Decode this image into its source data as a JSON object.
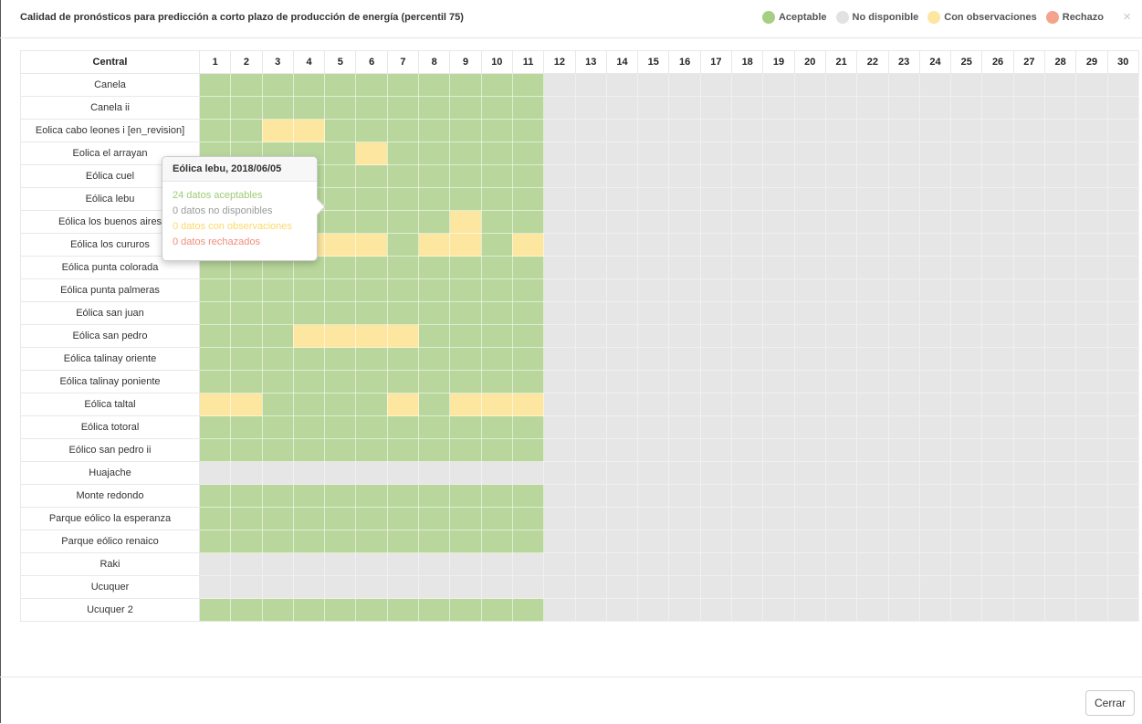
{
  "title": "Calidad de pronósticos para predicción a corto plazo de producción de energía (percentil 75)",
  "legend": [
    {
      "label": "Aceptable",
      "color": "#a6cf83"
    },
    {
      "label": "No disponible",
      "color": "#e2e2e2"
    },
    {
      "label": "Con observaciones",
      "color": "#fde6a0"
    },
    {
      "label": "Rechazo",
      "color": "#f4a48c"
    }
  ],
  "close_icon": "close-icon",
  "table": {
    "central_header": "Central",
    "days": [
      "1",
      "2",
      "3",
      "4",
      "5",
      "6",
      "7",
      "8",
      "9",
      "10",
      "11",
      "12",
      "13",
      "14",
      "15",
      "16",
      "17",
      "18",
      "19",
      "20",
      "21",
      "22",
      "23",
      "24",
      "25",
      "26",
      "27",
      "28",
      "29",
      "30"
    ],
    "status_colors": {
      "A": "#b9d79c",
      "N": "#e6e6e6",
      "O": "#fde6a0",
      "R": "#f4a48c"
    },
    "rows": [
      {
        "name": "Canela",
        "status": "AAAAAAAAAAANNNNNNNNNNNNNNNNNNN"
      },
      {
        "name": "Canela ii",
        "status": "AAAAAAAAAAANNNNNNNNNNNNNNNNNNN"
      },
      {
        "name": "Eolica cabo leones i [en_revision]",
        "status": "AAOOAAAAAAANNNNNNNNNNNNNNNNNNN"
      },
      {
        "name": "Eolica el arrayan",
        "status": "AAAAAOAAAAANNNNNNNNNNNNNNNNNNN"
      },
      {
        "name": "Eólica cuel",
        "status": "AAAAAAAAAAANNNNNNNNNNNNNNNNNNN"
      },
      {
        "name": "Eólica lebu",
        "status": "AAAAAAAAAAANNNNNNNNNNNNNNNNNNN"
      },
      {
        "name": "Eólica los buenos aires",
        "status": "AAAAAAAAOAANNNNNNNNNNNNNNNNNNN"
      },
      {
        "name": "Eólica los cururos",
        "status": "OOOOOOAOOAONNNNNNNNNNNNNNNNNNN"
      },
      {
        "name": "Eólica punta colorada",
        "status": "AAAAAAAAAAANNNNNNNNNNNNNNNNNNN"
      },
      {
        "name": "Eólica punta palmeras",
        "status": "AAAAAAAAAAANNNNNNNNNNNNNNNNNNN"
      },
      {
        "name": "Eólica san juan",
        "status": "AAAAAAAAAAANNNNNNNNNNNNNNNNNNN"
      },
      {
        "name": "Eólica san pedro",
        "status": "AAAOOOOAAAANNNNNNNNNNNNNNNNNNN"
      },
      {
        "name": "Eólica talinay oriente",
        "status": "AAAAAAAAAAANNNNNNNNNNNNNNNNNNN"
      },
      {
        "name": "Eólica talinay poniente",
        "status": "AAAAAAAAAAANNNNNNNNNNNNNNNNNNN"
      },
      {
        "name": "Eólica taltal",
        "status": "OOAAAAOAOOONNNNNNNNNNNNNNNNNNN"
      },
      {
        "name": "Eólica totoral",
        "status": "AAAAAAAAAAANNNNNNNNNNNNNNNNNNN"
      },
      {
        "name": "Eólico san pedro ii",
        "status": "AAAAAAAAAAANNNNNNNNNNNNNNNNNNN"
      },
      {
        "name": "Huajache",
        "status": "NNNNNNNNNNNNNNNNNNNNNNNNNNNNNN"
      },
      {
        "name": "Monte redondo",
        "status": "AAAAAAAAAAANNNNNNNNNNNNNNNNNNN"
      },
      {
        "name": "Parque eólico la esperanza",
        "status": "AAAAAAAAAAANNNNNNNNNNNNNNNNNNN"
      },
      {
        "name": "Parque eólico renaico",
        "status": "AAAAAAAAAAANNNNNNNNNNNNNNNNNNN"
      },
      {
        "name": "Raki",
        "status": "NNNNNNNNNNNNNNNNNNNNNNNNNNNNNN"
      },
      {
        "name": "Ucuquer",
        "status": "NNNNNNNNNNNNNNNNNNNNNNNNNNNNNN"
      },
      {
        "name": "Ucuquer 2",
        "status": "AAAAAAAAAAANNNNNNNNNNNNNNNNNNN"
      }
    ]
  },
  "tooltip": {
    "title": "Eólica lebu, 2018/06/05",
    "lines": [
      {
        "text": "24 datos aceptables",
        "color": "#9ccc76"
      },
      {
        "text": "0 datos no disponibles",
        "color": "#999999"
      },
      {
        "text": "0 datos con observaciones",
        "color": "#fbd96a"
      },
      {
        "text": "0 datos rechazados",
        "color": "#f28c7a"
      }
    ]
  },
  "footer": {
    "close_label": "Cerrar"
  }
}
